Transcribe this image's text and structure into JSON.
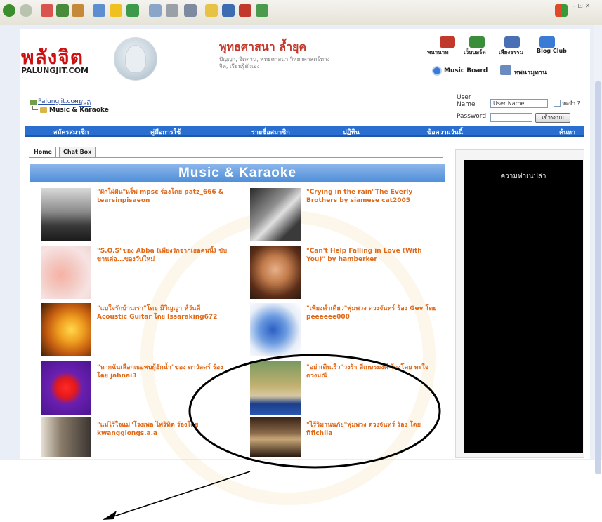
{
  "site": {
    "logo": "พลังจิต",
    "logo_sub": "PALUNGJIT.COM",
    "header_title": "พุทธศาสนา ล้ำยุค",
    "header_sub": "ปัญญา, จิตตาน, พุทธศาสนา วิทยาศาสตร์ทางจิต, เรียนรู้ตัวเอง"
  },
  "header_icons": [
    {
      "label": "พนานาท",
      "color": "#c0392b"
    },
    {
      "label": "เว็บบอร์ด",
      "color": "#3a8e3a"
    },
    {
      "label": "เสียงธรรม",
      "color": "#4a6fb5"
    },
    {
      "label": "Blog Club",
      "color": "#3a7bd5"
    }
  ],
  "music_board": "Music Board",
  "tv_card": "ทพนามุทาน",
  "breadcrumb": {
    "root": "Palungjit.com",
    "sep": "»",
    "section": "มัลติ",
    "current": "Music & Karaoke"
  },
  "login": {
    "user_label": "User Name",
    "user_value": "User Name",
    "password_label": "Password",
    "remember": "จดจำ ?",
    "button": "เข้าระบบ"
  },
  "nav": [
    "สมัครสมาชิก",
    "คู่มือการใช้",
    "รายชื่อสมาชิก",
    "ปฏิทิน",
    "ข้อความวันนี้",
    "ค้นหา"
  ],
  "tabs": [
    "Home",
    "Chat Box"
  ],
  "section_title": "Music & Karaoke",
  "songs": [
    {
      "title": "\"ฝักใฝ่ฝัน\"แร็พ mpsc ร้องโดย patz_666 & tearsinpisaeon",
      "thumb": "landscape"
    },
    {
      "title": "\"Crying in the rain\"The Everly Brothers by siamese cat2005",
      "thumb": "bw"
    },
    {
      "title": "\"S.O.S\"ของ Abba (เพียงรักจากเธอคนนี้) ขับขานต่อ...ของวันใหม่",
      "thumb": "pink"
    },
    {
      "title": "\"Can't Help Falling in Love (With You)\" by hamberker",
      "thumb": "girl"
    },
    {
      "title": "\"แบใจรักบ้านเรา\"โดย มิวิญญา ห์วันดี Acoustic Guitar โดย Issaraking672",
      "thumb": "sunset"
    },
    {
      "title": "\"เพียงคำเดียว\"พุ่มพวง ดวงจันทร์ ร้อง Gev โดย peeeeee000",
      "thumb": "dancer"
    },
    {
      "title": "\"หากฉันเลือกเธอพบผู้ฮักน้ำ\"ของ ดาวัลดร์ ร้อง โดย jahnai3",
      "thumb": "heart"
    },
    {
      "title": "\"อย่าเดินเร็ว\"วงร้า ลีเกษรมงค์ ร้องโดย ทะใจดวงมณี",
      "thumb": "couple"
    },
    {
      "title": "\"แม่ไร้ใจแม่\"โรงเพล ไพริทิต ร้องโดย kwangglongs.a.a",
      "thumb": "portrait"
    },
    {
      "title": "\"ไร้วิมานนภัย\"พุ่มพวง ดวงจันทร์ ร้อง โดย fifichila",
      "thumb": "street"
    }
  ],
  "side_panel_title": "ความทำเนปล่า",
  "colors": {
    "nav": "#2a6fd0",
    "song_title": "#e06a1a",
    "logo": "#cc1010"
  }
}
